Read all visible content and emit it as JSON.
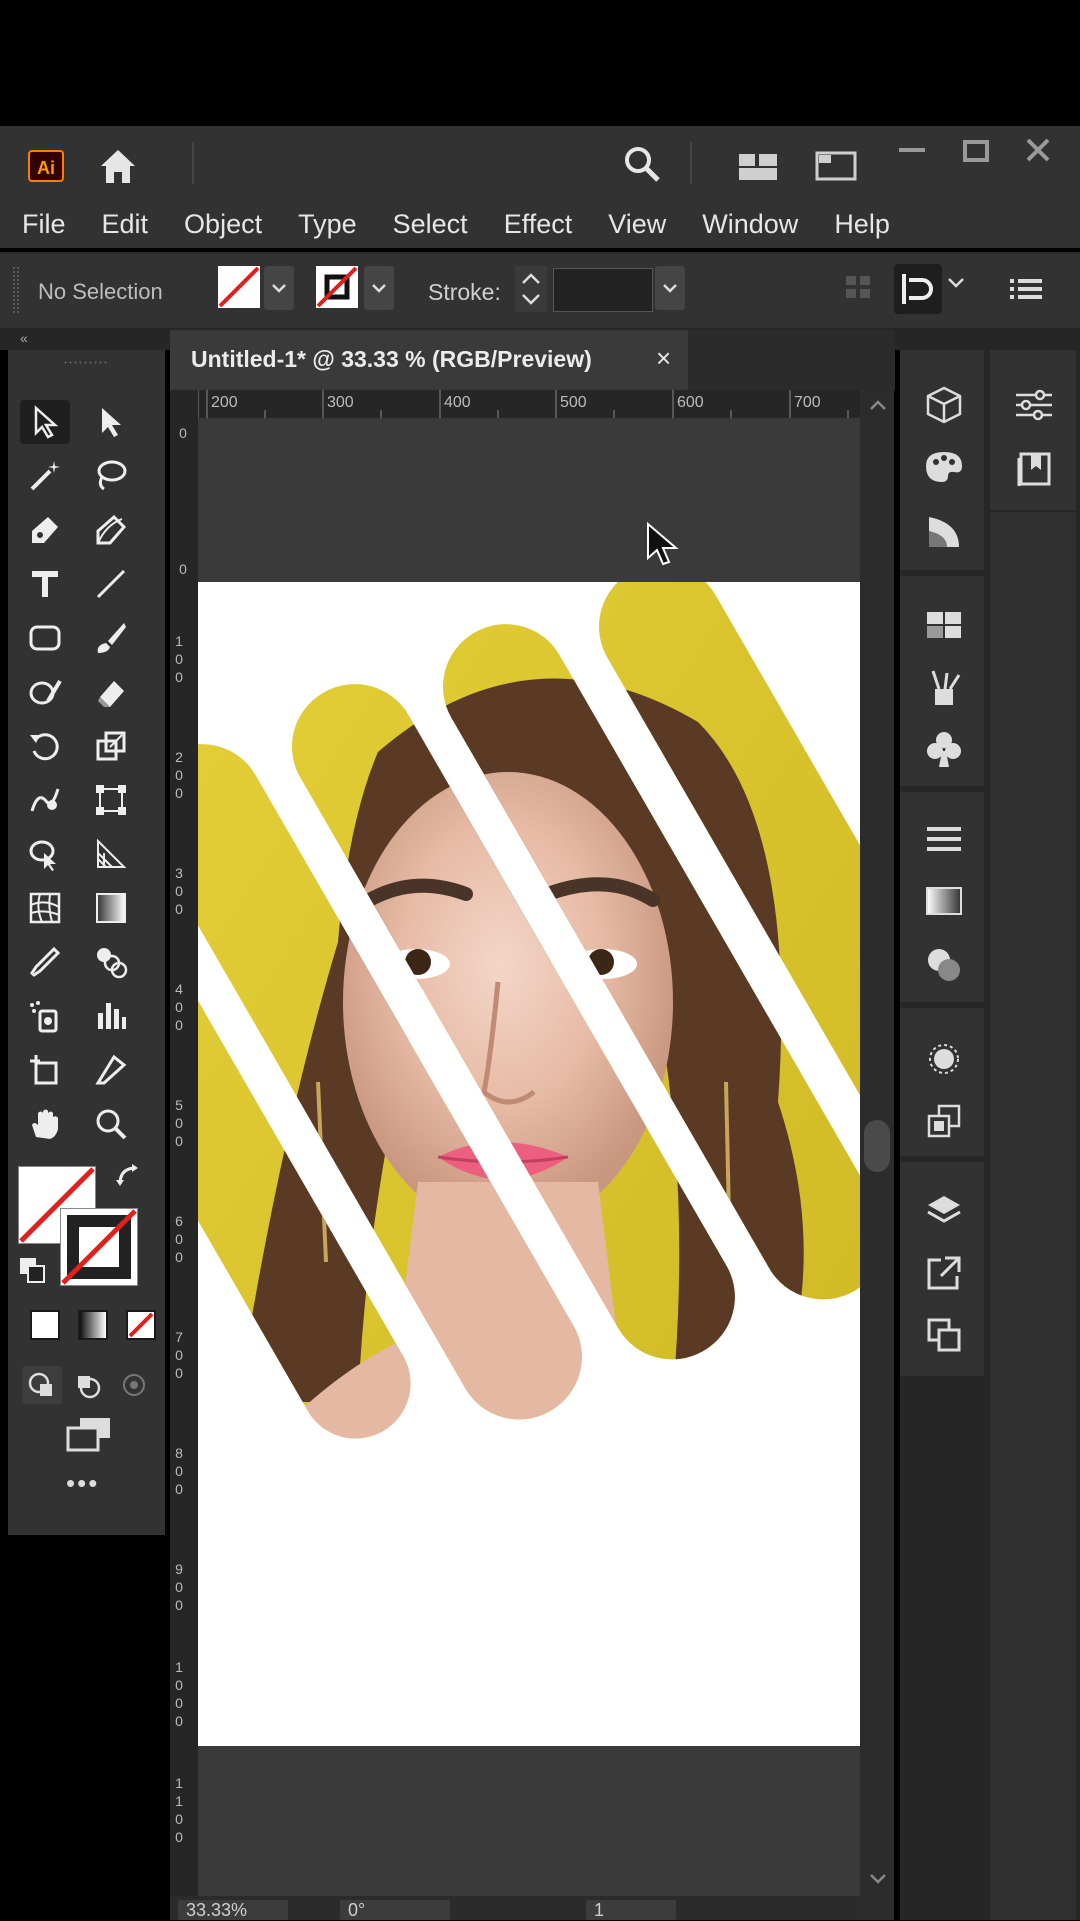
{
  "app": {
    "logo_text": "Ai"
  },
  "menu": [
    "File",
    "Edit",
    "Object",
    "Type",
    "Select",
    "Effect",
    "View",
    "Window",
    "Help"
  ],
  "control_bar": {
    "selection_status": "No Selection",
    "stroke_label": "Stroke:"
  },
  "document": {
    "tab_title": "Untitled-1* @ 33.33 % (RGB/Preview)",
    "close_glyph": "×"
  },
  "ruler": {
    "horizontal": [
      "200",
      "300",
      "400",
      "500",
      "600",
      "700"
    ],
    "vertical": [
      "0",
      "0",
      "1 0 0",
      "2 0 0",
      "3 0 0",
      "4 0 0",
      "5 0 0",
      "6 0 0",
      "7 0 0",
      "8 0 0",
      "9 0 0",
      "1 0 0 0",
      "1 1 0 0"
    ]
  },
  "status_bar": {
    "zoom": "33.33%",
    "rotation": "0°",
    "artboard": "1"
  },
  "colors": {
    "accent_yellow": "#d8c428",
    "artboard": "#ffffff",
    "ui_dark": "#323232"
  }
}
